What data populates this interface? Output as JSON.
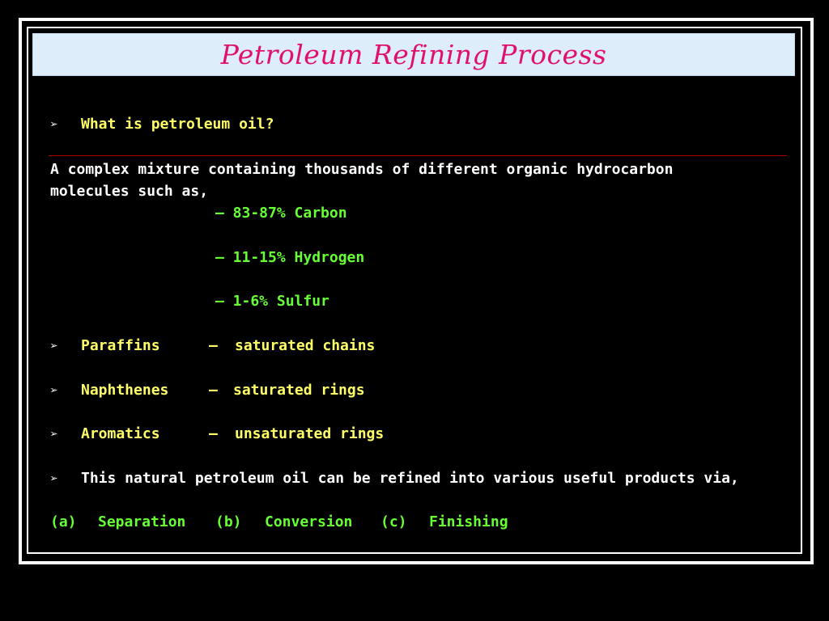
{
  "title": "Petroleum Refining Process",
  "question": "What is petroleum oil?",
  "definition": {
    "line1": "A complex mixture containing thousands of different organic hydrocarbon",
    "line2": "molecules such as,"
  },
  "composition": [
    "– 83-87% Carbon",
    "– 11-15% Hydrogen",
    "– 1-6% Sulfur"
  ],
  "classes": [
    {
      "name": "Paraffins",
      "dash": "–",
      "desc": "saturated chains"
    },
    {
      "name": "Naphthenes",
      "dash": "–",
      "desc": "saturated rings"
    },
    {
      "name": "Aromatics",
      "dash": "–",
      "desc": "unsaturated rings"
    }
  ],
  "summary": "This natural petroleum oil can be refined into various useful products via,",
  "steps": [
    {
      "label": "(a)",
      "name": "Separation"
    },
    {
      "label": "(b)",
      "name": "Conversion"
    },
    {
      "label": "(c)",
      "name": "Finishing"
    }
  ],
  "colors": {
    "title": "#e0106e",
    "title_bg": "#ddeefa",
    "bullet_text": "#ffff66",
    "body_text": "#ffffff",
    "highlight": "#66ff33",
    "divider": "#aa0000"
  },
  "icons": {
    "bullet": "arrow-bullet-icon"
  }
}
